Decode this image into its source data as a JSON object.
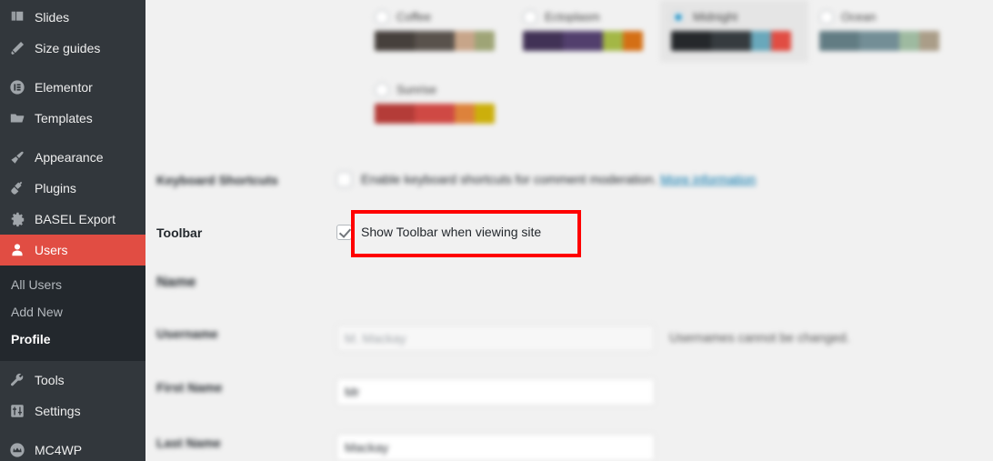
{
  "sidebar": {
    "background": "#32373c",
    "submenu_background": "#23282d",
    "current_color": "#e14d43",
    "items": [
      {
        "label": "Slides",
        "icon": "slides-icon",
        "current": false
      },
      {
        "label": "Size guides",
        "icon": "ruler-icon",
        "current": false
      },
      {
        "label": "Elementor",
        "icon": "elementor-icon",
        "current": false
      },
      {
        "label": "Templates",
        "icon": "folder-icon",
        "current": false
      },
      {
        "label": "Appearance",
        "icon": "paintbrush-icon",
        "current": false
      },
      {
        "label": "Plugins",
        "icon": "plugin-icon",
        "current": false
      },
      {
        "label": "BASEL Export",
        "icon": "gear-icon",
        "current": false
      },
      {
        "label": "Users",
        "icon": "user-icon",
        "current": true
      },
      {
        "label": "Tools",
        "icon": "wrench-icon",
        "current": false
      },
      {
        "label": "Settings",
        "icon": "sliders-icon",
        "current": false
      },
      {
        "label": "MC4WP",
        "icon": "mc4wp-icon",
        "current": false
      }
    ],
    "submenu": [
      {
        "label": "All Users",
        "current": false
      },
      {
        "label": "Add New",
        "current": false
      },
      {
        "label": "Profile",
        "current": true
      }
    ]
  },
  "color_schemes": {
    "row1": [
      {
        "name": "Coffee",
        "selected": false,
        "colors": [
          "#46403c",
          "#59524c",
          "#c7a589",
          "#9ea476"
        ]
      },
      {
        "name": "Ectoplasm",
        "selected": false,
        "colors": [
          "#413256",
          "#523f6d",
          "#a3b745",
          "#d46f15"
        ]
      },
      {
        "name": "Midnight",
        "selected": true,
        "colors": [
          "#25282b",
          "#363b3f",
          "#69a8bb",
          "#e14d43"
        ]
      },
      {
        "name": "Ocean",
        "selected": false,
        "colors": [
          "#627c83",
          "#738e96",
          "#9ebaa0",
          "#aa9d88"
        ]
      }
    ],
    "row2": [
      {
        "name": "Sunrise",
        "selected": false,
        "colors": [
          "#b43c38",
          "#cf4944",
          "#dd823b",
          "#ccaf0b"
        ]
      }
    ]
  },
  "form": {
    "keyboard_shortcuts": {
      "label": "Keyboard Shortcuts",
      "checkbox_text": "Enable keyboard shortcuts for comment moderation.",
      "link_text": "More information",
      "checked": false
    },
    "toolbar": {
      "label": "Toolbar",
      "checkbox_text": "Show Toolbar when viewing site",
      "checked": true
    },
    "name_section_title": "Name",
    "username": {
      "label": "Username",
      "value": "M. Mackay",
      "note": "Usernames cannot be changed."
    },
    "first_name": {
      "label": "First Name",
      "value": "Mr"
    },
    "last_name": {
      "label": "Last Name",
      "value": "Mackay"
    }
  },
  "annotation": {
    "color": "#ff0000",
    "target": "toolbar-checkbox-row"
  }
}
